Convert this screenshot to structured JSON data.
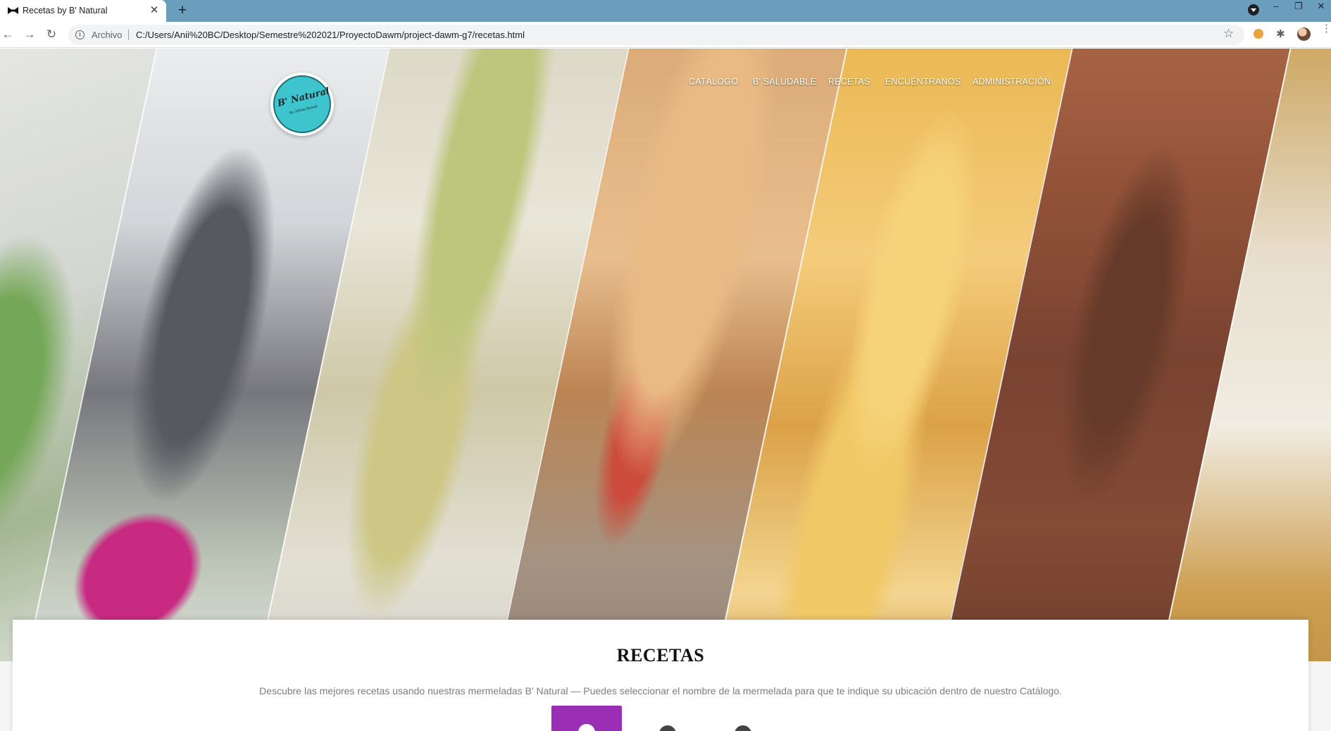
{
  "browser": {
    "tab_title": "Recetas by B' Natural",
    "tab_close": "✕",
    "new_tab": "+",
    "scheme_label": "Archivo",
    "url": "C:/Users/Anii%20BC/Desktop/Semestre%202021/ProyectoDawm/project-dawm-g7/recetas.html",
    "back": "←",
    "forward": "→",
    "reload": "↻",
    "star": "☆",
    "minimize": "–",
    "restore": "❐",
    "close": "✕",
    "menu": "⋮"
  },
  "site": {
    "logo_text": "B' Natural",
    "logo_sub": "By Jolinda Beauté",
    "nav": [
      "CATÁLOGO",
      "B' SALUDABLE",
      "RECETAS",
      "ENCUÉNTRANOS",
      "ADMINISTRACIÓN"
    ]
  },
  "content": {
    "title": "RECETAS",
    "description": "Descubre las mejores recetas usando nuestras mermeladas B' Natural — Puedes seleccionar el nombre de la mermelada para que te indique su ubicación dentro de nuestro Catálogo."
  },
  "colors": {
    "tabbar": "#6b9ebd",
    "accent_purple": "#9a2fb5",
    "logo_teal": "#3ec4cc"
  },
  "icons": [
    "bow-tie-favicon-icon",
    "info-icon",
    "star-icon",
    "cookie-extension-icon",
    "puzzle-extension-icon",
    "profile-avatar-icon"
  ]
}
